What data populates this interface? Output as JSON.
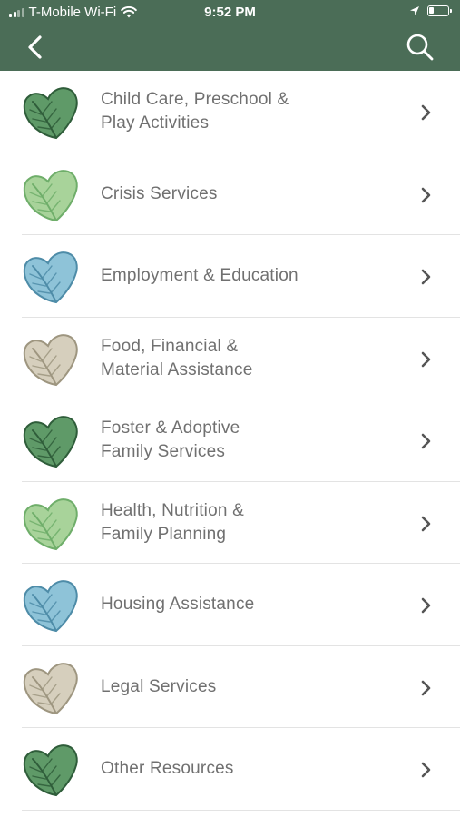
{
  "status_bar": {
    "carrier": "T-Mobile Wi-Fi",
    "time": "9:52 PM"
  },
  "nav": {
    "back_icon": "chevron-left-icon",
    "search_icon": "search-icon",
    "background": "#4b6d57"
  },
  "categories": [
    {
      "line1": "Child Care, Preschool &",
      "line2": "Play Activities",
      "leaf_color": "#5f9a68",
      "leaf_dark": "#2f5d3a"
    },
    {
      "line1": "Crisis Services",
      "line2": "",
      "leaf_color": "#a8d39a",
      "leaf_dark": "#6fae6a"
    },
    {
      "line1": "Employment & Education",
      "line2": "",
      "leaf_color": "#8ec3d8",
      "leaf_dark": "#4e8ca8"
    },
    {
      "line1": "Food, Financial &",
      "line2": "Material Assistance",
      "leaf_color": "#d6cfbd",
      "leaf_dark": "#9e9680"
    },
    {
      "line1": "Foster & Adoptive",
      "line2": "Family Services",
      "leaf_color": "#5f9a68",
      "leaf_dark": "#2f5d3a"
    },
    {
      "line1": "Health, Nutrition &",
      "line2": "Family Planning",
      "leaf_color": "#a8d39a",
      "leaf_dark": "#6fae6a"
    },
    {
      "line1": "Housing Assistance",
      "line2": "",
      "leaf_color": "#8ec3d8",
      "leaf_dark": "#4e8ca8"
    },
    {
      "line1": "Legal Services",
      "line2": "",
      "leaf_color": "#d6cfbd",
      "leaf_dark": "#9e9680"
    },
    {
      "line1": "Other Resources",
      "line2": "",
      "leaf_color": "#5f9a68",
      "leaf_dark": "#2f5d3a"
    }
  ]
}
